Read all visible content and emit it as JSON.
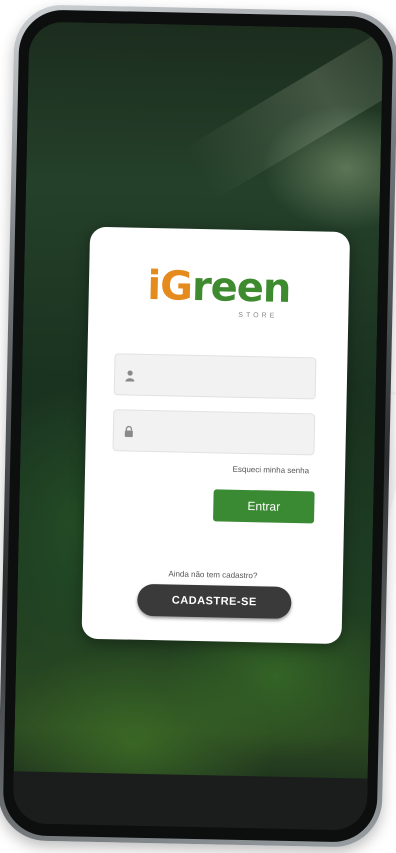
{
  "logo": {
    "word_start": "i",
    "word_accent": "G",
    "word_end": "reen",
    "subtitle": "STORE"
  },
  "login": {
    "username_placeholder": "",
    "password_placeholder": "",
    "forgot_password": "Esqueci minha senha",
    "enter_button": "Entrar",
    "register_question": "Ainda não tem cadastro?",
    "register_button": "CADASTRE-SE"
  },
  "icons": {
    "user": "user-icon",
    "lock": "lock-icon"
  },
  "colors": {
    "brand_green": "#3a8a34",
    "brand_orange": "#e58a1c",
    "register_button": "#3a3a3a"
  }
}
